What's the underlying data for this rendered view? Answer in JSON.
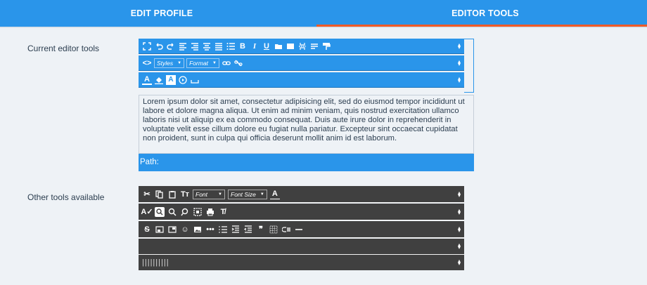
{
  "tabs": [
    {
      "label": "EDIT PROFILE"
    },
    {
      "label": "EDITOR TOOLS"
    }
  ],
  "sections": {
    "current_label": "Current editor tools",
    "other_label": "Other tools available"
  },
  "editor": {
    "styles_label": "Styles",
    "format_label": "Format",
    "content": "Lorem ipsum dolor sit amet, consectetur adipisicing elit, sed do eiusmod tempor incididunt ut labore et dolore magna aliqua. Ut enim ad minim veniam, quis nostrud exercitation ullamco laboris nisi ut aliquip ex ea commodo consequat. Duis aute irure dolor in reprehenderit in voluptate velit esse cillum dolore eu fugiat nulla pariatur. Excepteur sint occaecat cupidatat non proident, sunt in culpa qui officia deserunt mollit anim id est laborum.",
    "path_label": "Path:"
  },
  "available": {
    "font_label": "Font",
    "font_size_label": "Font Size",
    "separators": "||||||||||"
  },
  "icons": {
    "row1_blue": [
      "maximize-icon",
      "undo-icon",
      "redo-icon",
      "align-left-icon",
      "align-right-icon",
      "align-center-icon",
      "align-justify-icon",
      "bullet-list-icon",
      "bold-icon",
      "italic-icon",
      "underline-icon",
      "folder-icon",
      "media-icon",
      "page-break-icon",
      "paragraph-icon",
      "format-painter-icon"
    ],
    "row2_blue": [
      "source-code-icon",
      "link-icon",
      "unlink-icon"
    ],
    "row3_blue": [
      "text-color-icon",
      "background-color-icon",
      "text-box-icon",
      "play-icon",
      "space-icon"
    ]
  },
  "colors": {
    "accent": "#2a95ea",
    "tab_indicator": "#f05a28",
    "dark_toolbar": "#404040",
    "background": "#eef2f6"
  }
}
